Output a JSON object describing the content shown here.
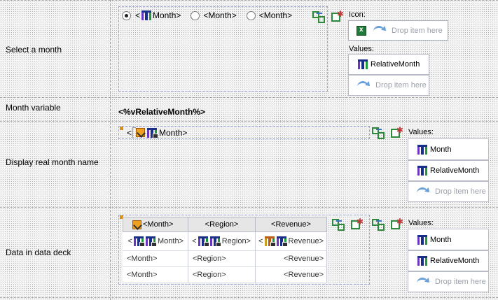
{
  "rows": [
    {
      "label": "Select a month"
    },
    {
      "label": "Month variable"
    },
    {
      "label": "Display real month name"
    },
    {
      "label": "Data in data deck"
    }
  ],
  "radios": [
    "<",
    "Month>",
    "<Month>",
    "<Month>"
  ],
  "icon_section": {
    "title": "Icon:",
    "drop": "Drop item here"
  },
  "values_select": {
    "title": "Values:",
    "items": [
      "RelativeMonth"
    ],
    "drop": "Drop item here"
  },
  "variable_text": "<%vRelativeMonth%>",
  "display_field": {
    "prefix": "<",
    "suffix": "Month>"
  },
  "values_display": {
    "title": "Values:",
    "items": [
      "Month",
      "RelativeMonth"
    ],
    "drop": "Drop item here"
  },
  "deck": {
    "headers": [
      "<Month>",
      "<Region>",
      "<Revenue>"
    ],
    "icon_row": [
      "Month>",
      "Region>",
      "Revenue>"
    ],
    "icon_row_prefix": "<",
    "rows": [
      [
        "<Month>",
        "<Region>",
        "<Revenue>"
      ],
      [
        "<Month>",
        "<Region>",
        "<Revenue>"
      ]
    ]
  },
  "values_deck": {
    "title": "Values:",
    "items": [
      "Month",
      "RelativeMonth"
    ],
    "drop": "Drop item here"
  }
}
